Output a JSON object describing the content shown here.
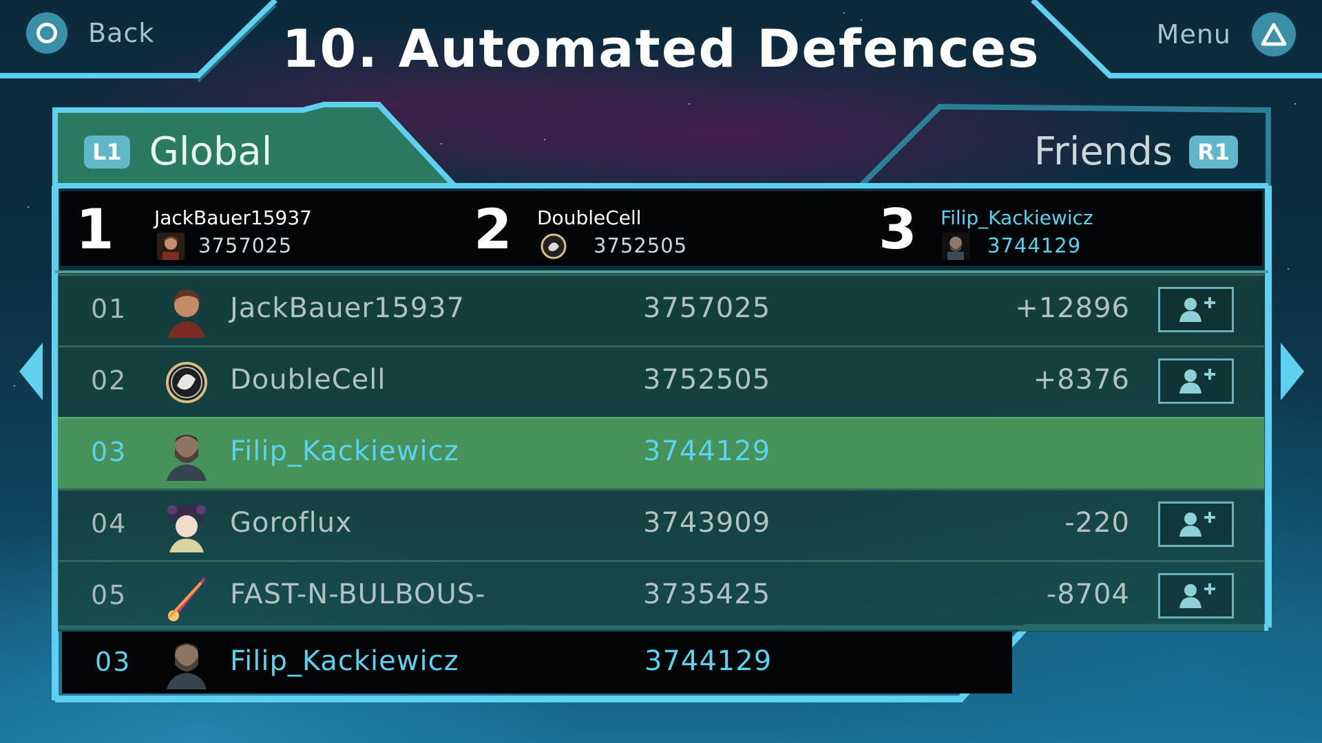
{
  "header": {
    "back_label": "Back",
    "menu_label": "Menu",
    "title": "10. Automated Defences"
  },
  "tabs": {
    "global": {
      "badge": "L1",
      "label": "Global"
    },
    "friends": {
      "badge": "R1",
      "label": "Friends"
    }
  },
  "podium": [
    {
      "rank": "1",
      "name": "JackBauer15937",
      "score": "3757025"
    },
    {
      "rank": "2",
      "name": "DoubleCell",
      "score": "3752505"
    },
    {
      "rank": "3",
      "name": "Filip_Kackiewicz",
      "score": "3744129"
    }
  ],
  "leaderboard": [
    {
      "rank": "01",
      "name": "JackBauer15937",
      "score": "3757025",
      "diff": "+12896"
    },
    {
      "rank": "02",
      "name": "DoubleCell",
      "score": "3752505",
      "diff": "+8376"
    },
    {
      "rank": "03",
      "name": "Filip_Kackiewicz",
      "score": "3744129",
      "diff": ""
    },
    {
      "rank": "04",
      "name": "Goroflux",
      "score": "3743909",
      "diff": "-220"
    },
    {
      "rank": "05",
      "name": "FAST-N-BULBOUS-",
      "score": "3735425",
      "diff": "-8704"
    }
  ],
  "self": {
    "rank": "03",
    "name": "Filip_Kackiewicz",
    "score": "3744129"
  },
  "colors": {
    "frame": "#5fd0ee",
    "highlight_row": "#47915a",
    "highlight_text": "#5cd3ee",
    "tab_active": "#2a7a62"
  },
  "icons": {
    "back": "circle-button-icon",
    "menu": "triangle-button-icon",
    "add_friend": "add-friend-icon",
    "prev": "arrow-left-icon",
    "next": "arrow-right-icon"
  }
}
